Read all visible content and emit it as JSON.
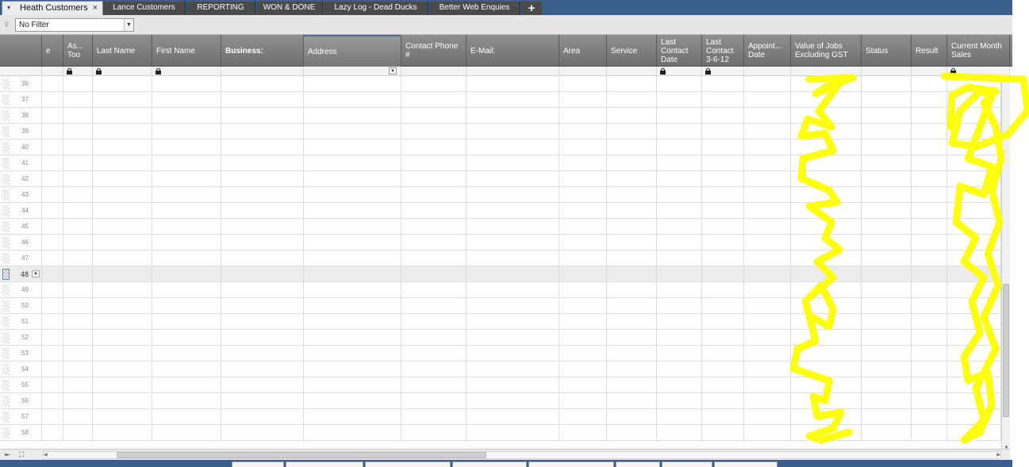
{
  "tabs": [
    {
      "label": "Heath Customers",
      "active": true
    },
    {
      "label": "Lance Customers",
      "active": false
    },
    {
      "label": "REPORTING",
      "active": false
    },
    {
      "label": "WON & DONE",
      "active": false
    },
    {
      "label": "Lazy Log - Dead Ducks",
      "active": false
    },
    {
      "label": "Better Web Enquies",
      "active": false
    }
  ],
  "tab_close_glyph": "×",
  "tab_add_glyph": "+",
  "filter": {
    "selected": "No Filter"
  },
  "columns": [
    {
      "label": "e",
      "bold": false
    },
    {
      "label": "As...\nToo",
      "bold": false
    },
    {
      "label": "Last Name",
      "bold": false
    },
    {
      "label": "First Name",
      "bold": false
    },
    {
      "label": "Business:",
      "bold": true
    },
    {
      "label": "Address",
      "bold": false
    },
    {
      "label": "Contact Phone\n#",
      "bold": false
    },
    {
      "label": "E-Mail:",
      "bold": false
    },
    {
      "label": "Area",
      "bold": false
    },
    {
      "label": "Service",
      "bold": false
    },
    {
      "label": "Last\nContact\nDate",
      "bold": false
    },
    {
      "label": "Last\nContact\n3-6-12",
      "bold": false
    },
    {
      "label": "Appoint...\nDate",
      "bold": false
    },
    {
      "label": "Value of Jobs\nExcluding GST",
      "bold": false
    },
    {
      "label": "Status",
      "bold": false
    },
    {
      "label": "Result",
      "bold": false
    },
    {
      "label": "Current Month\nSales",
      "bold": false
    }
  ],
  "locked_columns": [
    "As...\nToo",
    "Last Name",
    "First Name",
    "Last\nContact\nDate",
    "Last\nContact\n3-6-12",
    "Current Month\nSales"
  ],
  "dropdown_column": "Address",
  "rows": [
    {
      "num": "36"
    },
    {
      "num": "37"
    },
    {
      "num": "38"
    },
    {
      "num": "39"
    },
    {
      "num": "40"
    },
    {
      "num": "41"
    },
    {
      "num": "42"
    },
    {
      "num": "43"
    },
    {
      "num": "44"
    },
    {
      "num": "45"
    },
    {
      "num": "46"
    },
    {
      "num": "47"
    },
    {
      "num": "48",
      "selected": true
    },
    {
      "num": "49"
    },
    {
      "num": "50"
    },
    {
      "num": "51"
    },
    {
      "num": "52"
    },
    {
      "num": "53"
    },
    {
      "num": "54"
    },
    {
      "num": "55"
    },
    {
      "num": "56"
    },
    {
      "num": "57"
    },
    {
      "num": "58"
    }
  ],
  "colors": {
    "tabbar_bg": "#3a5f8c",
    "header_bg": "#7f7f7f",
    "selected_row": "#ececec",
    "annotation": "#ffff00"
  },
  "icons": {
    "filter": "filter-icon",
    "lock": "lock-icon",
    "first_record": "first-record-icon",
    "fit": "fit-to-screen-icon"
  }
}
